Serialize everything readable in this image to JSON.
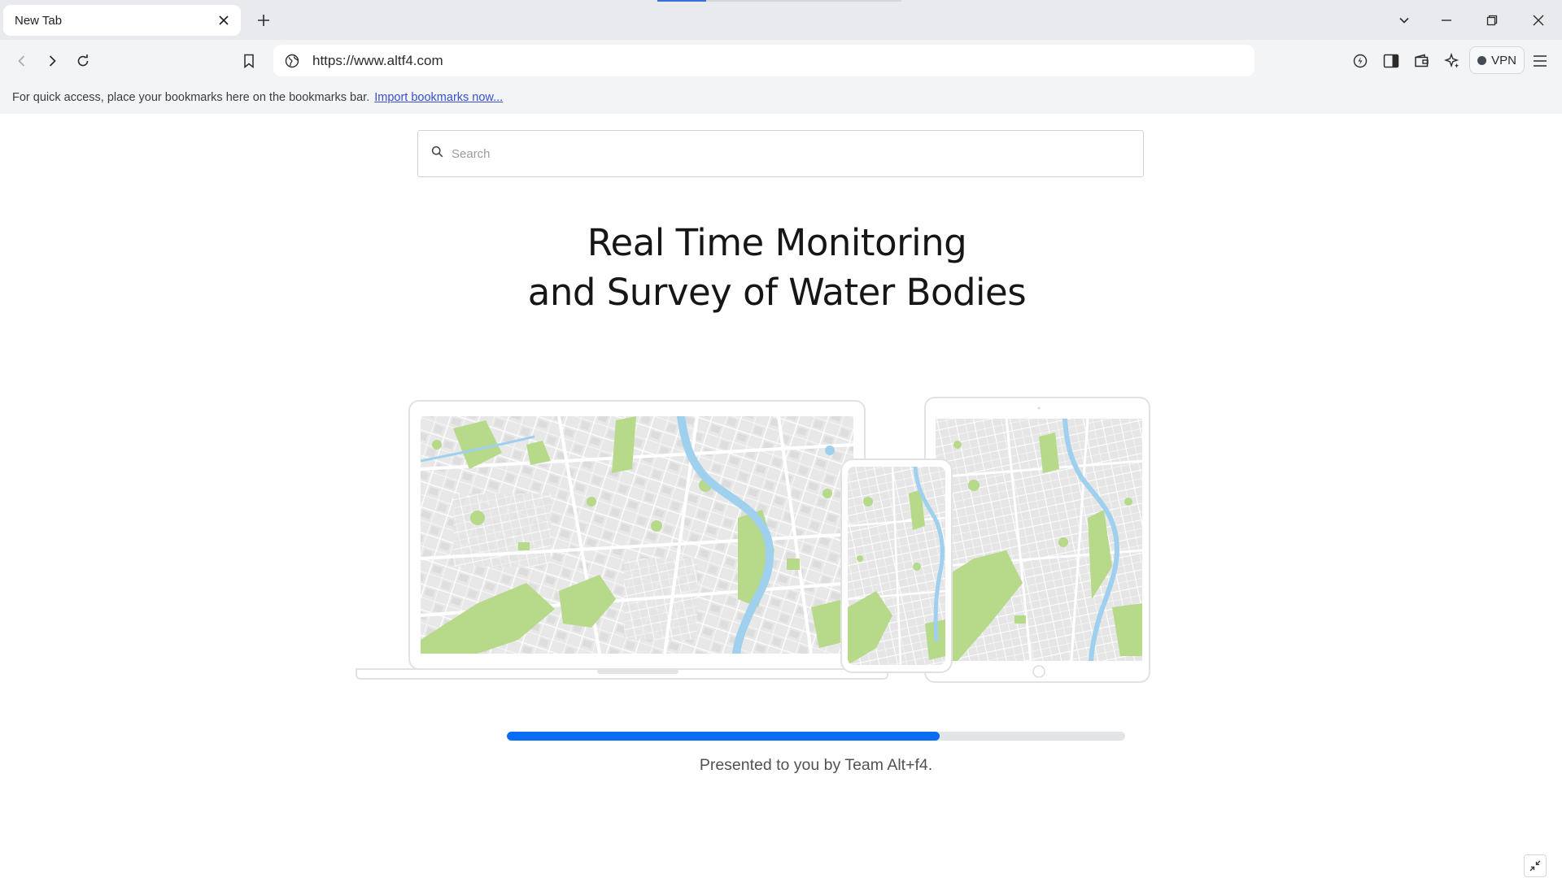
{
  "browser": {
    "tab": {
      "title": "New Tab"
    },
    "address_bar": {
      "url": "https://www.altf4.com"
    },
    "vpn_label": "VPN",
    "bookmarks_bar": {
      "message": "For quick access, place your bookmarks here on the bookmarks bar.",
      "import_link": "Import bookmarks now..."
    }
  },
  "page": {
    "search": {
      "placeholder": "Search",
      "value": ""
    },
    "headline_line1": "Real Time Monitoring",
    "headline_line2": "and Survey of Water Bodies",
    "progress_percent": 70,
    "footer_text": "Presented to you by Team Alt+f4."
  },
  "colors": {
    "accent": "#0a6cf0",
    "map_land": "#e9e9e9",
    "map_park": "#b6d98a",
    "map_water": "#9fd0ee",
    "map_road": "#ffffff"
  }
}
